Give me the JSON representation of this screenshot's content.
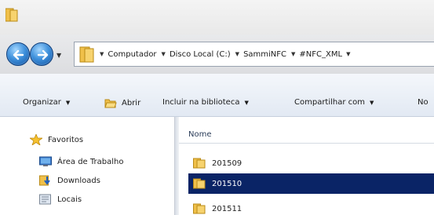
{
  "window": {
    "title_icon": "folder-icon"
  },
  "nav": {
    "back_icon": "back-arrow-icon",
    "forward_icon": "forward-arrow-icon",
    "history_icon": "dropdown-arrow-icon"
  },
  "address": {
    "crumbs": [
      "Computador",
      "Disco Local (C:)",
      "SammiNFC",
      "#NFC_XML"
    ],
    "separator_icon": "breadcrumb-arrow-icon"
  },
  "toolbar": {
    "organize": "Organizar",
    "open": "Abrir",
    "include_library": "Incluir na biblioteca",
    "share_with": "Compartilhar com",
    "new_truncated": "No"
  },
  "sidebar": {
    "favorites": "Favoritos",
    "items": [
      "Área de Trabalho",
      "Downloads",
      "Locais"
    ]
  },
  "content": {
    "column_name": "Nome",
    "files": [
      {
        "name": "201509",
        "selected": false
      },
      {
        "name": "201510",
        "selected": true
      },
      {
        "name": "201511",
        "selected": false
      }
    ]
  },
  "colors": {
    "selection": "#0a2466",
    "folder": "#f2c14e"
  }
}
